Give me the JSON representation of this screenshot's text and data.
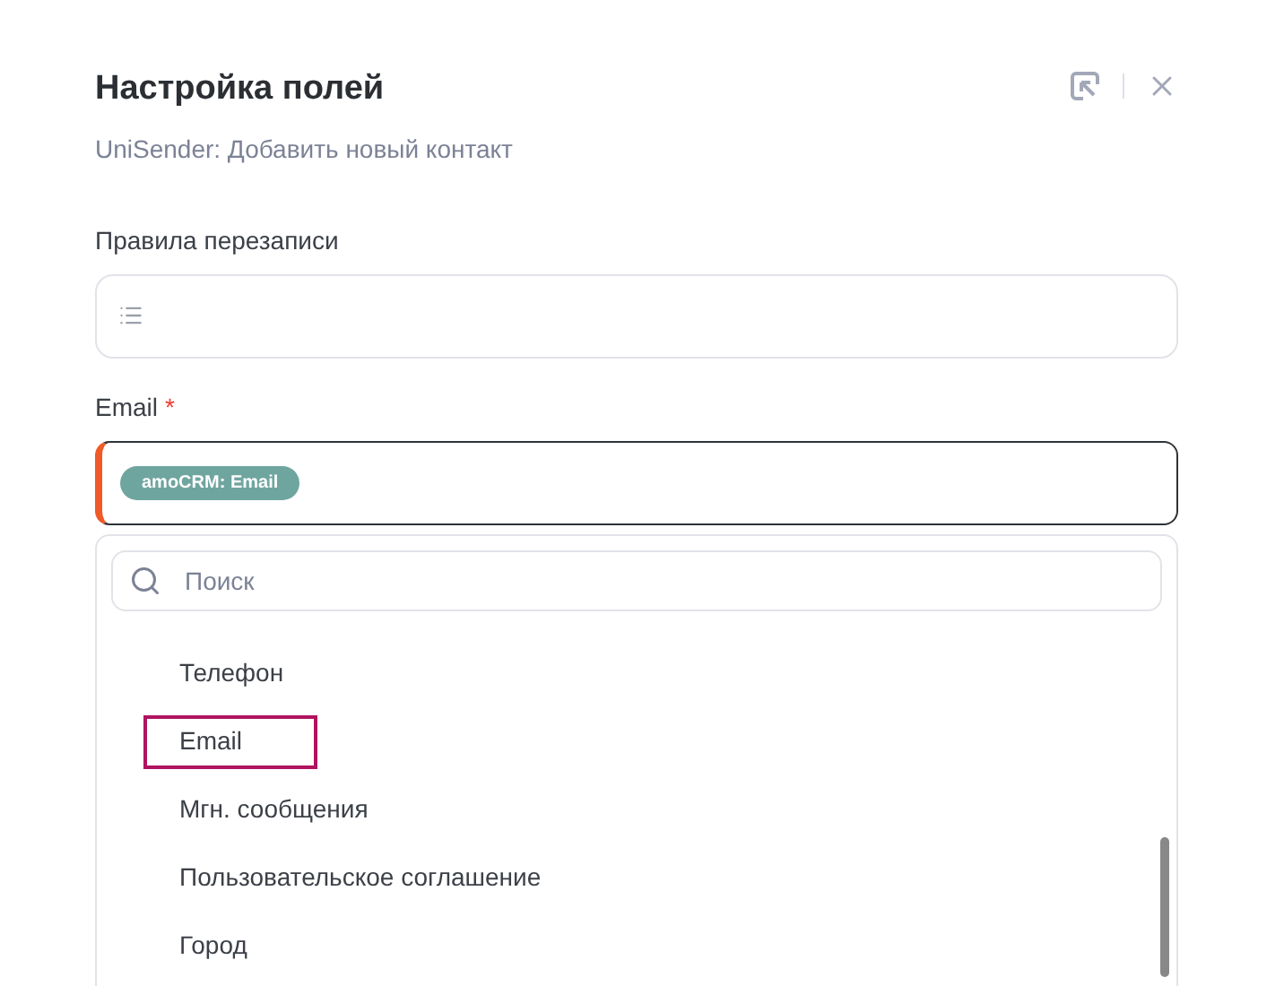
{
  "dialog": {
    "title": "Настройка полей",
    "subtitle": "UniSender: Добавить новый контакт"
  },
  "fields": [
    {
      "label": "Правила перезаписи",
      "kind": "list",
      "required": false
    },
    {
      "label": "Email",
      "kind": "tags",
      "required": true,
      "required_mark": "*",
      "tags": [
        "amoCRM: Email"
      ]
    }
  ],
  "dropdown": {
    "search": {
      "placeholder": "Поиск"
    },
    "items": [
      {
        "label": "Телефон",
        "selected": false
      },
      {
        "label": "Email",
        "selected": true
      },
      {
        "label": "Мгн. сообщения",
        "selected": false
      },
      {
        "label": "Пользовательское соглашение",
        "selected": false
      },
      {
        "label": "Город",
        "selected": false
      }
    ]
  }
}
